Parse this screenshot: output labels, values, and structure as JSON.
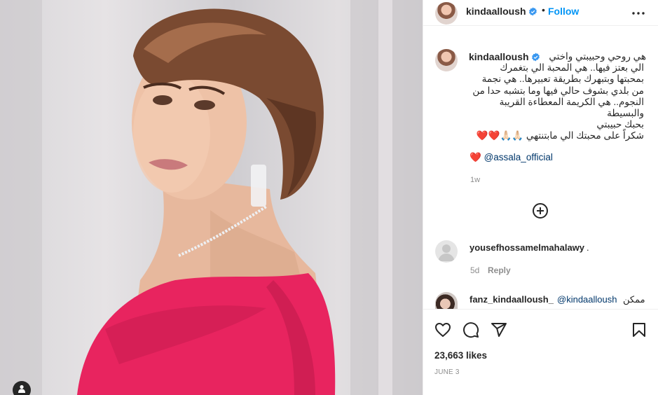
{
  "post": {
    "username": "kindaalloush",
    "follow_label": "Follow",
    "header_separator": "•",
    "caption_lines": [
      "هي روحي وحبيبتي واختي",
      "الي بعتز فيها.. هي المحبة الي بتغمرك",
      "بمحبتها وبتبهرك بطريقة تعبيرها.. هي نجمة",
      "من بلدي بشوف حالي فيها وما بتشبه حدا من",
      "النجوم.. هي الكريمة المعطاءة القريبة",
      "والبسيطة",
      "بحبك حبيبتي",
      "شكراً على محبتك الي مابتنتهي"
    ],
    "caption_emoji": "🙏🏻🙏🏻❤️❤️",
    "mention_line": "@assala_official",
    "mention_heart": "❤️",
    "caption_age": "1w",
    "likes": "23,663 likes",
    "date": "JUNE 3"
  },
  "comments": [
    {
      "username": "yousefhossamelmahalawy",
      "text": ".",
      "age": "5d",
      "reply_label": "Reply"
    },
    {
      "username": "fanz_kindaalloush_",
      "mention": "@kindaalloush",
      "text": "ممكن"
    }
  ],
  "icons": {
    "verified": "verified-badge-icon",
    "more": "more-options-icon",
    "add_comments": "plus-circle-icon",
    "like": "heart-icon",
    "comment": "comment-icon",
    "share": "share-icon",
    "save": "bookmark-icon",
    "tags": "user-tag-icon"
  },
  "colors": {
    "accent": "#0095f6",
    "verified": "#3897f0",
    "muted": "#8e8e8e",
    "dress": "#e8245f",
    "mention": "#00376b"
  }
}
